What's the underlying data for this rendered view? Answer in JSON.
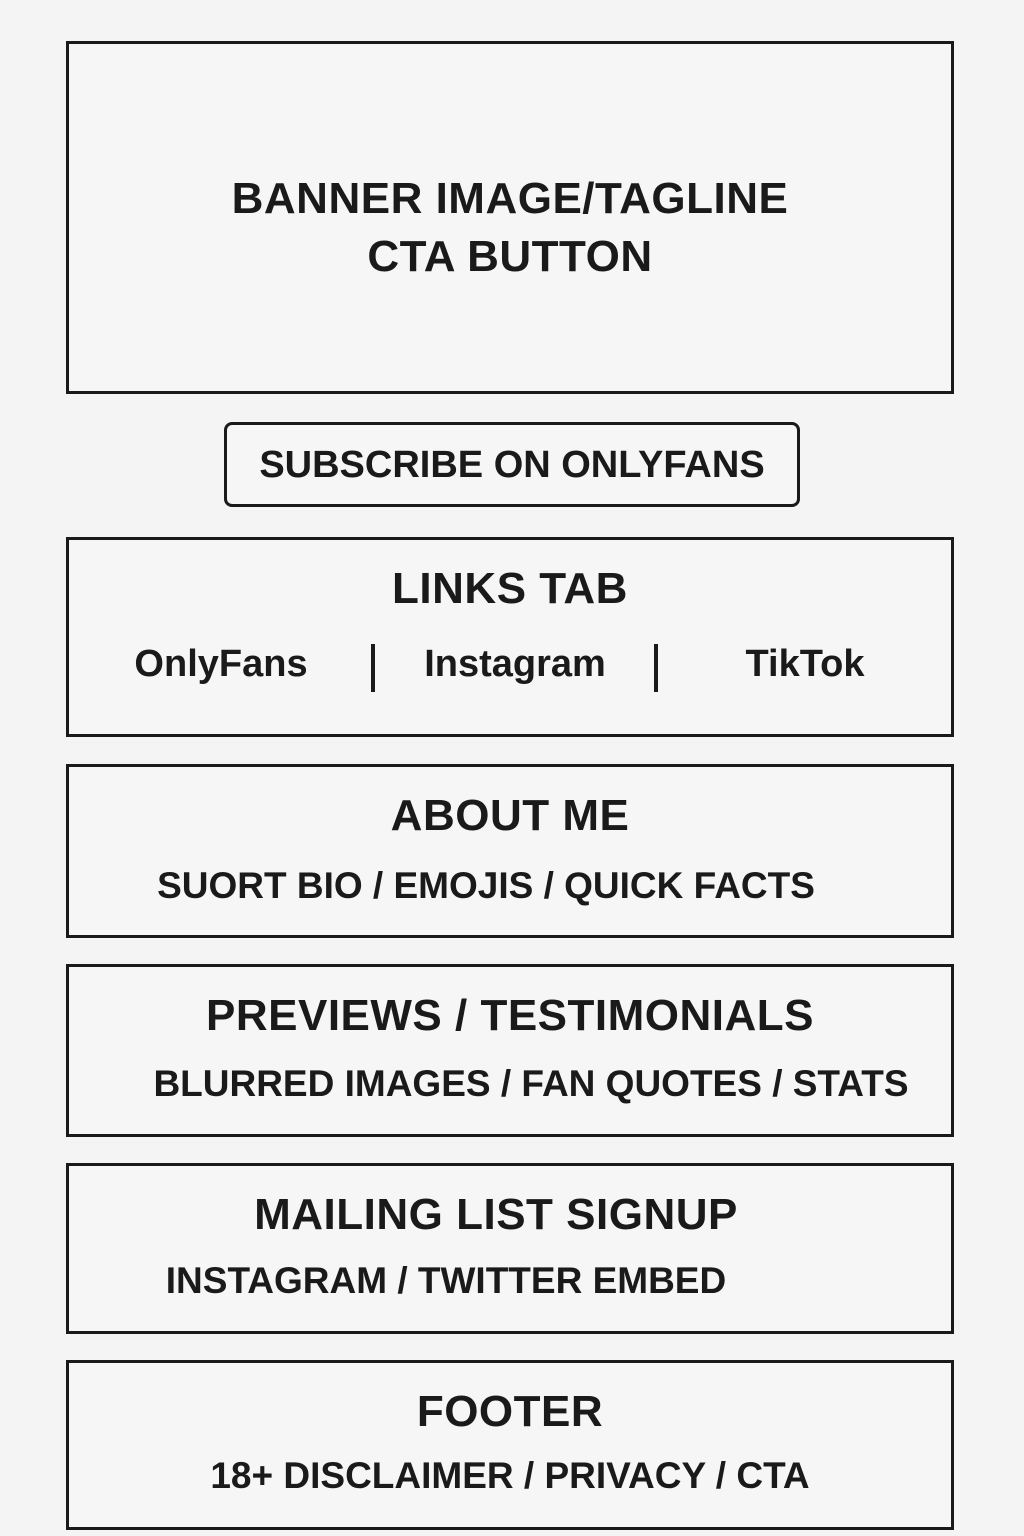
{
  "banner": {
    "line1": "BANNER IMAGE/TAGLINE",
    "line2": "CTA BUTTON"
  },
  "subscribe": {
    "label": "SUBSCRIBE ON ONLYFANS"
  },
  "links_tab": {
    "title": "LINKS TAB",
    "links": [
      "OnlyFans",
      "Instagram",
      "TikTok"
    ]
  },
  "about": {
    "title": "ABOUT ME",
    "subtitle": "SUORT BIO / EMOJIS / QUICK FACTS"
  },
  "previews": {
    "title": "PREVIEWS / TESTIMONIALS",
    "subtitle": "BLURRED IMAGES / FAN QUOTES / STATS"
  },
  "mailing": {
    "title": "MAILING LIST SIGNUP",
    "subtitle": "INSTAGRAM / TWITTER EMBED"
  },
  "footer": {
    "title": "FOOTER",
    "subtitle": "18+ DISCLAIMER / PRIVACY / CTA"
  }
}
